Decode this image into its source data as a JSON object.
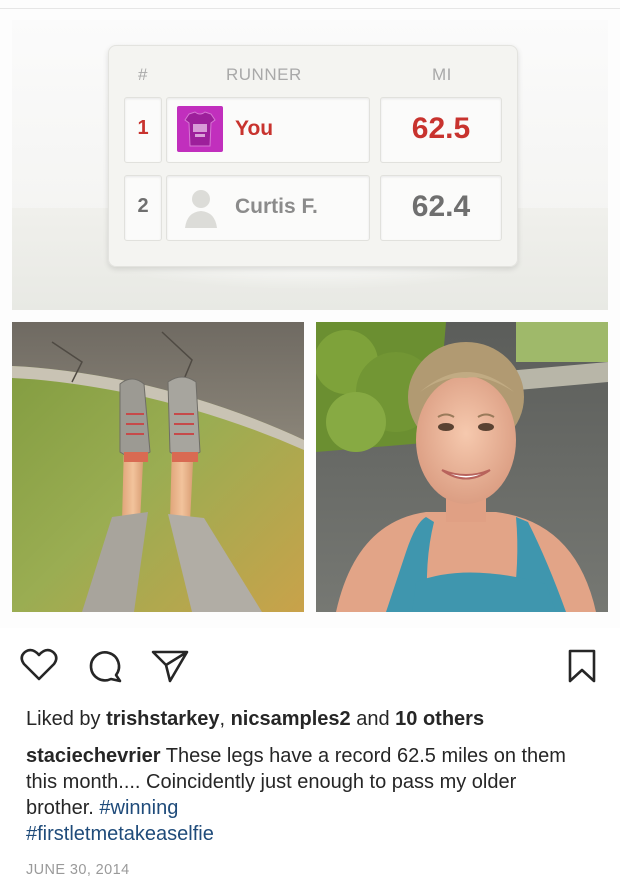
{
  "leaderboard": {
    "headers": {
      "rank": "#",
      "runner": "RUNNER",
      "distance": "MI"
    },
    "rows": [
      {
        "rank": "1",
        "name": "You",
        "miles": "62.5",
        "avatar": "purple-shirt"
      },
      {
        "rank": "2",
        "name": "Curtis F.",
        "miles": "62.4",
        "avatar": "person-silhouette"
      }
    ],
    "colors": {
      "leader": "#c8332e",
      "other": "#6f6f6f"
    }
  },
  "photos": {
    "left": "legs-in-running-shoes-on-grass",
    "right": "smiling-selfie-in-blue-tank-top"
  },
  "actions": {
    "like": "heart-icon",
    "comment": "comment-icon",
    "share": "send-icon",
    "save": "bookmark-icon"
  },
  "likes": {
    "prefix": "Liked by ",
    "user1": "trishstarkey",
    "sep": ", ",
    "user2": "nicsamples2",
    "and": " and ",
    "others": "10 others"
  },
  "caption": {
    "username": "staciechevrier",
    "text": " These legs have a record 62.5 miles on them this month.... Coincidently just enough to pass my older brother. ",
    "hashtag1": "#winning",
    "hashtag2": "#firstletmetakeaselfie"
  },
  "date": "JUNE 30, 2014"
}
